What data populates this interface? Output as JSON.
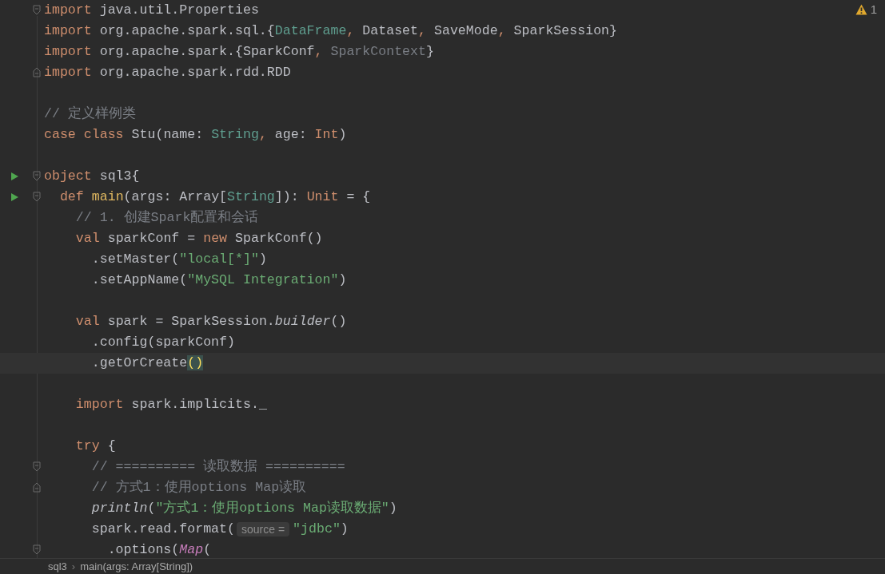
{
  "editor": {
    "warnings": {
      "count": "1"
    },
    "lines": [
      {
        "kind": "fold-start",
        "tokens": [
          {
            "text": "import",
            "kind": "kw"
          },
          {
            "text": " java.util.Properties",
            "kind": "plain"
          }
        ]
      },
      {
        "kind": "plain",
        "tokens": [
          {
            "text": "import",
            "kind": "kw"
          },
          {
            "text": " org.apache.spark.sql.{",
            "kind": "plain"
          },
          {
            "text": "DataFrame",
            "kind": "type"
          },
          {
            "text": ", ",
            "kind": "kw"
          },
          {
            "text": "Dataset",
            "kind": "plain"
          },
          {
            "text": ", ",
            "kind": "kw"
          },
          {
            "text": "SaveMode",
            "kind": "plain"
          },
          {
            "text": ", ",
            "kind": "kw"
          },
          {
            "text": "SparkSession}",
            "kind": "plain"
          }
        ]
      },
      {
        "kind": "plain",
        "tokens": [
          {
            "text": "import",
            "kind": "kw"
          },
          {
            "text": " org.apache.spark.{SparkConf",
            "kind": "plain"
          },
          {
            "text": ", ",
            "kind": "kw"
          },
          {
            "text": "SparkContext",
            "kind": "dim"
          },
          {
            "text": "}",
            "kind": "plain"
          }
        ]
      },
      {
        "kind": "fold-end",
        "tokens": [
          {
            "text": "import",
            "kind": "kw"
          },
          {
            "text": " org.apache.spark.rdd.RDD",
            "kind": "plain"
          }
        ]
      },
      {
        "kind": "blank"
      },
      {
        "kind": "plain",
        "tokens": [
          {
            "text": "// 定义样例类",
            "kind": "comment"
          }
        ]
      },
      {
        "kind": "plain",
        "tokens": [
          {
            "text": "case class",
            "kind": "kw"
          },
          {
            "text": " Stu(name: ",
            "kind": "plain"
          },
          {
            "text": "String",
            "kind": "type"
          },
          {
            "text": ", ",
            "kind": "kw"
          },
          {
            "text": "age: ",
            "kind": "plain"
          },
          {
            "text": "Int",
            "kind": "kw"
          },
          {
            "text": ")",
            "kind": "plain"
          }
        ]
      },
      {
        "kind": "blank"
      },
      {
        "kind": "run-fold",
        "tokens": [
          {
            "text": "object",
            "kind": "kw"
          },
          {
            "text": " sql3{",
            "kind": "plain"
          }
        ]
      },
      {
        "kind": "run-fold",
        "tokens": [
          {
            "text": "  def",
            "kind": "kw"
          },
          {
            "text": " main",
            "kind": "fn"
          },
          {
            "text": "(args: Array[",
            "kind": "plain"
          },
          {
            "text": "String",
            "kind": "type"
          },
          {
            "text": "]): ",
            "kind": "plain"
          },
          {
            "text": "Unit",
            "kind": "kw"
          },
          {
            "text": " = {",
            "kind": "plain"
          }
        ]
      },
      {
        "kind": "plain",
        "tokens": [
          {
            "text": "    // 1. 创建Spark配置和会话",
            "kind": "comment"
          }
        ]
      },
      {
        "kind": "plain",
        "tokens": [
          {
            "text": "    val",
            "kind": "kw"
          },
          {
            "text": " sparkConf = ",
            "kind": "plain"
          },
          {
            "text": "new",
            "kind": "kw"
          },
          {
            "text": " SparkConf()",
            "kind": "plain"
          }
        ]
      },
      {
        "kind": "plain",
        "tokens": [
          {
            "text": "      .setMaster(",
            "kind": "plain"
          },
          {
            "text": "\"local[*]\"",
            "kind": "str"
          },
          {
            "text": ")",
            "kind": "plain"
          }
        ]
      },
      {
        "kind": "plain",
        "tokens": [
          {
            "text": "      .setAppName(",
            "kind": "plain"
          },
          {
            "text": "\"MySQL Integration\"",
            "kind": "str"
          },
          {
            "text": ")",
            "kind": "plain"
          }
        ]
      },
      {
        "kind": "blank"
      },
      {
        "kind": "plain",
        "tokens": [
          {
            "text": "    val",
            "kind": "kw"
          },
          {
            "text": " spark = SparkSession.",
            "kind": "plain"
          },
          {
            "text": "builder",
            "kind": "ital"
          },
          {
            "text": "()",
            "kind": "plain"
          }
        ]
      },
      {
        "kind": "plain",
        "tokens": [
          {
            "text": "      .config(sparkConf)",
            "kind": "plain"
          }
        ]
      },
      {
        "kind": "plain",
        "current": true,
        "tokens": [
          {
            "text": "      .getOrCreate",
            "kind": "plain"
          },
          {
            "text": "()",
            "kind": "match"
          }
        ]
      },
      {
        "kind": "blank"
      },
      {
        "kind": "plain",
        "tokens": [
          {
            "text": "    import",
            "kind": "kw"
          },
          {
            "text": " spark.implicits._",
            "kind": "plain"
          }
        ]
      },
      {
        "kind": "blank"
      },
      {
        "kind": "plain",
        "tokens": [
          {
            "text": "    try",
            "kind": "kw"
          },
          {
            "text": " {",
            "kind": "plain"
          }
        ]
      },
      {
        "kind": "fold-start",
        "tokens": [
          {
            "text": "      // ========== 读取数据 ==========",
            "kind": "comment"
          }
        ]
      },
      {
        "kind": "fold-end",
        "tokens": [
          {
            "text": "      // 方式1：使用options Map读取",
            "kind": "comment"
          }
        ]
      },
      {
        "kind": "plain",
        "tokens": [
          {
            "text": "      println",
            "kind": "ital"
          },
          {
            "text": "(",
            "kind": "plain"
          },
          {
            "text": "\"方式1：使用options Map读取数据\"",
            "kind": "str"
          },
          {
            "text": ")",
            "kind": "plain"
          }
        ]
      },
      {
        "kind": "plain",
        "tokens": [
          {
            "text": "      spark.read.format(",
            "kind": "plain"
          },
          {
            "text": "source =",
            "kind": "hint"
          },
          {
            "text": "\"jdbc\"",
            "kind": "str"
          },
          {
            "text": ")",
            "kind": "plain"
          }
        ]
      },
      {
        "kind": "fold-start",
        "tokens": [
          {
            "text": "        .options(",
            "kind": "plain"
          },
          {
            "text": "Map",
            "kind": "call"
          },
          {
            "text": "(",
            "kind": "plain"
          }
        ]
      }
    ],
    "breadcrumb": {
      "separator": "›",
      "items": [
        {
          "label": "sql3"
        },
        {
          "label": "main(args: Array[String])"
        }
      ]
    }
  }
}
